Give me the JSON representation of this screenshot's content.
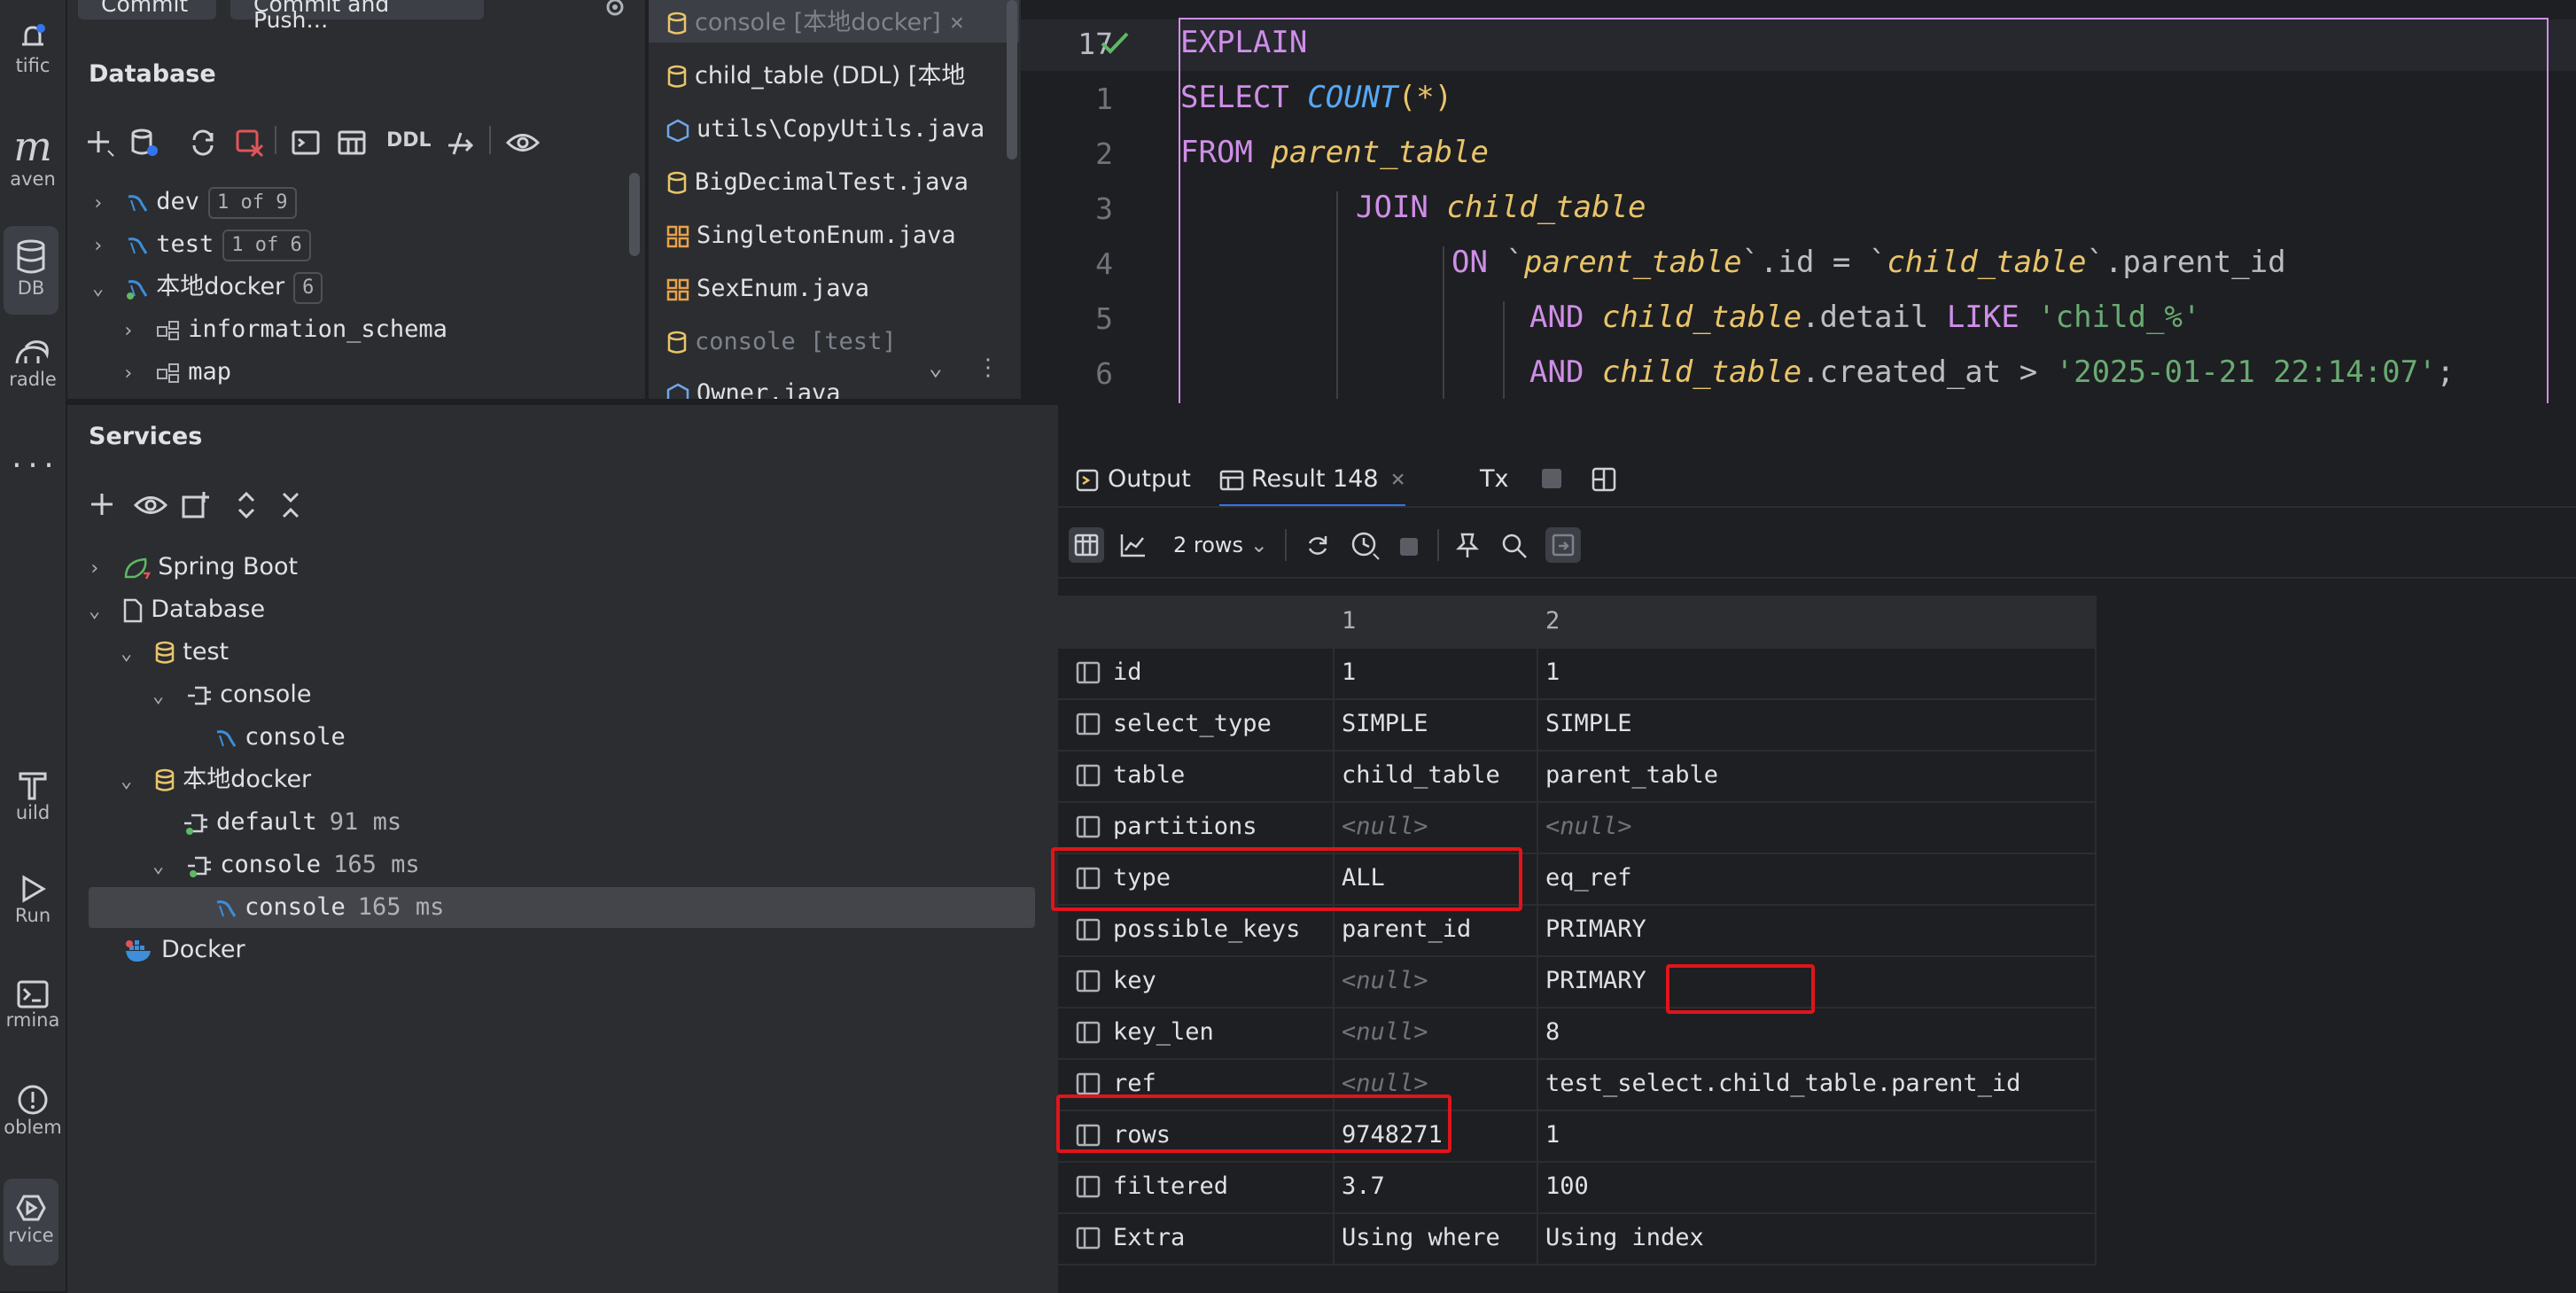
{
  "strip": {
    "items": [
      {
        "label": "tific",
        "icon": "bell-icon"
      },
      {
        "label": "aven",
        "icon": "maven-icon"
      },
      {
        "label": "DB",
        "icon": "database-icon"
      },
      {
        "label": "radle",
        "icon": "gradle-icon"
      },
      {
        "label": "...",
        "icon": "more-icon"
      },
      {
        "label": "uild",
        "icon": "hammer-icon"
      },
      {
        "label": "Run",
        "icon": "play-icon"
      },
      {
        "label": "rmina",
        "icon": "terminal-icon"
      },
      {
        "label": "oblem",
        "icon": "problems-icon"
      },
      {
        "label": "rvice",
        "icon": "services-icon"
      }
    ]
  },
  "topbar": {
    "commit": "Commit",
    "commit_push": "Commit and Push…"
  },
  "database": {
    "title": "Database",
    "toolbar_ddl": "DDL",
    "tree": [
      {
        "label": "dev",
        "badge": "1 of 9"
      },
      {
        "label": "test",
        "badge": "1 of 6"
      },
      {
        "label": "本地docker",
        "badge": "6"
      },
      {
        "label": "information_schema"
      },
      {
        "label": "map"
      }
    ]
  },
  "files": [
    {
      "label": "console [本地docker]",
      "dim": true
    },
    {
      "label": "child_table (DDL) [本地"
    },
    {
      "label": "utils\\CopyUtils.java"
    },
    {
      "label": "BigDecimalTest.java"
    },
    {
      "label": "SingletonEnum.java"
    },
    {
      "label": "SexEnum.java"
    },
    {
      "label": "console [test]",
      "dim": true
    },
    {
      "label": "Owner.java"
    }
  ],
  "editor": {
    "line_numbers": [
      "17",
      "1",
      "2",
      "3",
      "4",
      "5",
      "6"
    ],
    "code": {
      "l0": "EXPLAIN",
      "l1_kw": "SELECT ",
      "l1_fn": "COUNT",
      "l1_rest": "(*)",
      "l2_kw": "FROM ",
      "l2_tb": "parent_table",
      "l3_kw": "JOIN ",
      "l3_tb": "child_table",
      "l4_kw": "ON ",
      "l4_a": "`",
      "l4_tb1": "parent_table",
      "l4_b": "`.id = `",
      "l4_tb2": "child_table",
      "l4_c": "`.parent_id",
      "l5_kw": "AND ",
      "l5_tb": "child_table",
      "l5_mid": ".detail ",
      "l5_kw2": "LIKE ",
      "l5_str": "'child_%'",
      "l6_kw": "AND ",
      "l6_tb": "child_table",
      "l6_mid": ".created_at > ",
      "l6_str": "'2025-01-21 22:14:07'",
      "l6_end": ";"
    }
  },
  "services": {
    "title": "Services",
    "tree": [
      {
        "label": "Spring Boot"
      },
      {
        "label": "Database"
      },
      {
        "label": "test"
      },
      {
        "label": "console"
      },
      {
        "label": "console"
      },
      {
        "label": "本地docker"
      },
      {
        "label": "default",
        "time": "91 ms"
      },
      {
        "label": "console",
        "time": "165 ms"
      },
      {
        "label": "console",
        "time": "165 ms"
      },
      {
        "label": "Docker"
      }
    ]
  },
  "result": {
    "tabs": {
      "output": "Output",
      "result": "Result 148",
      "tx": "Tx"
    },
    "rows_label": "2 rows",
    "headers": [
      "",
      "1",
      "2"
    ],
    "rows": [
      [
        "id",
        "1",
        "1"
      ],
      [
        "select_type",
        "SIMPLE",
        "SIMPLE"
      ],
      [
        "table",
        "child_table",
        "parent_table"
      ],
      [
        "partitions",
        "<null>",
        "<null>"
      ],
      [
        "type",
        "ALL",
        "eq_ref"
      ],
      [
        "possible_keys",
        "parent_id",
        "PRIMARY"
      ],
      [
        "key",
        "<null>",
        "PRIMARY"
      ],
      [
        "key_len",
        "<null>",
        "8"
      ],
      [
        "ref",
        "<null>",
        "test_select.child_table.parent_id"
      ],
      [
        "rows",
        "9748271",
        "1"
      ],
      [
        "filtered",
        "3.7",
        "100"
      ],
      [
        "Extra",
        "Using where",
        "Using index"
      ]
    ]
  },
  "colors": {
    "highlight_box": "#e0141a",
    "accent": "#3574f0",
    "success": "#5fb865"
  }
}
